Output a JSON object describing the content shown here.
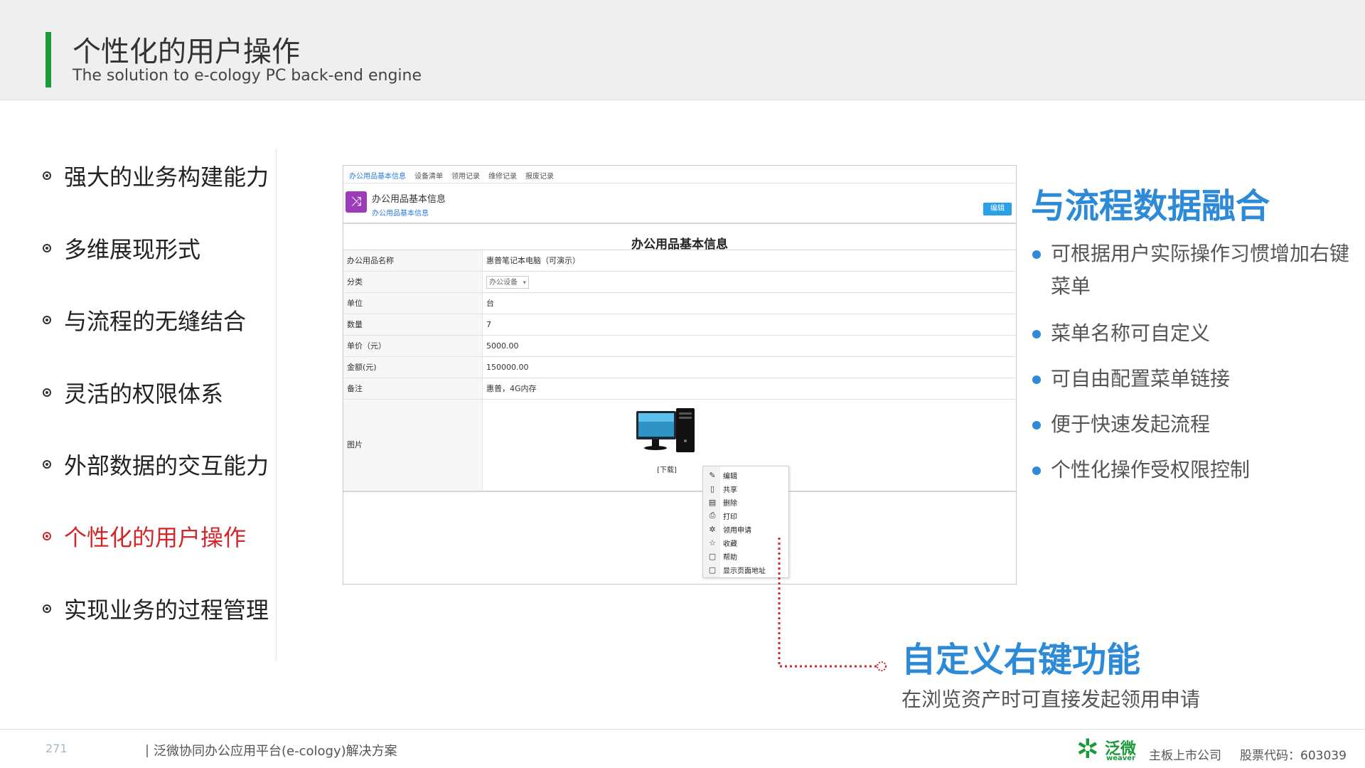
{
  "header": {
    "title": "个性化的用户操作",
    "subtitle": "The solution to e-cology PC back-end engine"
  },
  "nav": {
    "items": [
      {
        "label": "强大的业务构建能力",
        "active": false
      },
      {
        "label": "多维展现形式",
        "active": false
      },
      {
        "label": "与流程的无缝结合",
        "active": false
      },
      {
        "label": "灵活的权限体系",
        "active": false
      },
      {
        "label": "外部数据的交互能力",
        "active": false
      },
      {
        "label": "个性化的用户操作",
        "active": true
      },
      {
        "label": "实现业务的过程管理",
        "active": false
      }
    ]
  },
  "screenshot": {
    "tabs": [
      "办公用品基本信息",
      "设备清单",
      "领用记录",
      "维修记录",
      "报废记录"
    ],
    "header_title": "办公用品基本信息",
    "header_subtitle": "办公用品基本信息",
    "edit_button": "编辑",
    "form_title": "办公用品基本信息",
    "rows": [
      {
        "label": "办公用品名称",
        "value": "惠普笔记本电脑（可演示）"
      },
      {
        "label": "分类",
        "value": "办公设备"
      },
      {
        "label": "单位",
        "value": "台"
      },
      {
        "label": "数量",
        "value": "7"
      },
      {
        "label": "单价（元）",
        "value": "5000.00"
      },
      {
        "label": "金额(元)",
        "value": "150000.00"
      },
      {
        "label": "备注",
        "value": "惠普，4G内存"
      },
      {
        "label": "图片",
        "value": ""
      }
    ],
    "image_link": "[下载]",
    "context_menu": [
      {
        "label": "编辑",
        "icon": "edit-icon"
      },
      {
        "label": "共享",
        "icon": "share-icon"
      },
      {
        "label": "删除",
        "icon": "delete-icon"
      },
      {
        "label": "打印",
        "icon": "print-icon"
      },
      {
        "label": "领用申请",
        "icon": "gear-icon"
      },
      {
        "label": "收藏",
        "icon": "star-icon"
      },
      {
        "label": "帮助",
        "icon": "help-icon"
      },
      {
        "label": "显示页面地址",
        "icon": "page-icon"
      }
    ]
  },
  "right": {
    "title": "与流程数据融合",
    "points": [
      "可根据用户实际操作习惯增加右键",
      "菜单名称可自定义",
      "可自由配置菜单链接",
      "便于快速发起流程",
      "个性化操作受权限控制"
    ],
    "point1_cont": "菜单"
  },
  "annotation": {
    "title": "自定义右键功能",
    "subtitle": "在浏览资产时可直接发起领用申请"
  },
  "footer": {
    "page_number": "271",
    "product": "泛微协同办公应用平台(e-cology)解决方案",
    "logo_cn": "泛微",
    "logo_en": "weaver",
    "company": "主板上市公司",
    "stock": "股票代码：603039"
  },
  "colors": {
    "accent_green": "#1a9a3a",
    "accent_blue": "#2d8ad6",
    "active_red": "#d0282a"
  }
}
